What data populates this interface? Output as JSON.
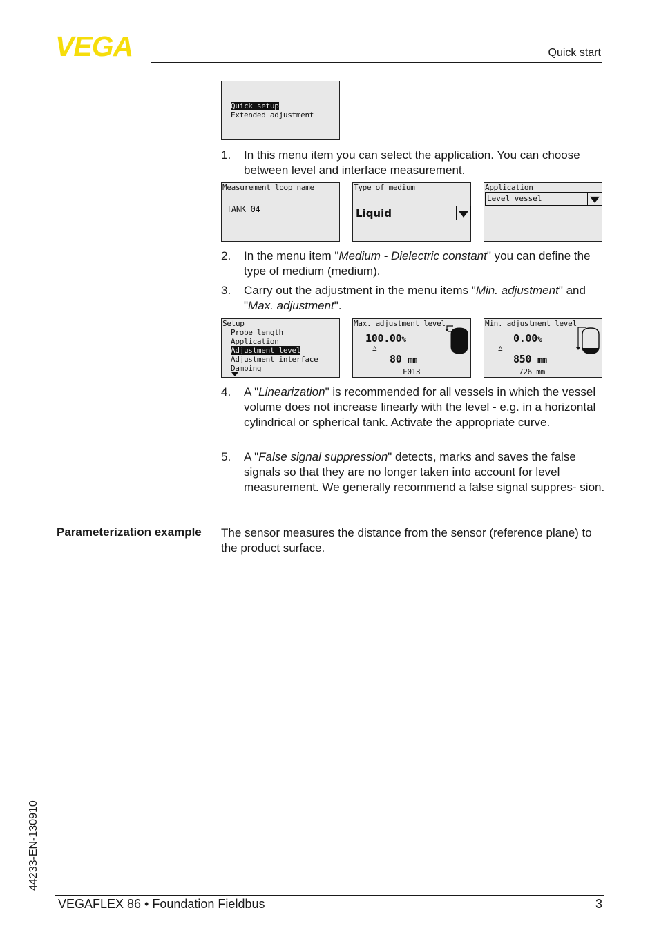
{
  "header": {
    "logo_text": "VEGA",
    "logo_color": "#f6dd0b",
    "section": "Quick start"
  },
  "screens": {
    "main_menu": {
      "items": [
        "Quick setup",
        "Extended adjustment"
      ],
      "selected": "Quick setup"
    },
    "loop_name": {
      "title": "Measurement loop name",
      "value": "TANK 04"
    },
    "medium": {
      "title": "Type of medium",
      "value": "Liquid"
    },
    "application": {
      "title": "Application",
      "value": "Level vessel"
    },
    "setup": {
      "title": "Setup",
      "items": [
        "Probe length",
        "Application",
        "Adjustment level",
        "Adjustment interface",
        "Damping"
      ],
      "selected": "Adjustment level"
    },
    "max_adj": {
      "title": "Max. adjustment level",
      "percent": "100.00",
      "percent_unit": "%",
      "equiv": "≙",
      "distance": "80",
      "distance_unit": "mm",
      "footer": "F013"
    },
    "min_adj": {
      "title": "Min. adjustment level",
      "percent": "0.00",
      "percent_unit": "%",
      "equiv": "≙",
      "distance": "850",
      "distance_unit": "mm",
      "footer": "726  mm"
    }
  },
  "steps": [
    {
      "num": "1.",
      "text": "In this menu item you can select the application. You can choose between level and interface measurement."
    },
    {
      "num": "2.",
      "pre": "In the menu item \"",
      "em": "Medium - Dielectric constant",
      "post": "\" you can define the type of medium (medium)."
    },
    {
      "num": "3.",
      "pre": "Carry out the adjustment in the menu items \"",
      "em": "Min. adjustment",
      "mid": "\" and \"",
      "em2": "Max. adjustment",
      "post": "\"."
    },
    {
      "num": "4.",
      "pre": "A \"",
      "em": "Linearization",
      "post": "\" is recommended for all vessels in which the vessel volume does not increase linearly with the level - e.g. in a horizontal cylindrical or spherical tank. Activate the appropriate curve."
    },
    {
      "num": "5.",
      "pre": "A \"",
      "em": "False signal suppression",
      "post": "\" detects, marks and saves the false signals so that they are no longer taken into account for level measurement. We generally recommend a false signal suppres- sion."
    }
  ],
  "param_example": {
    "label": "Parameterization example",
    "text": "The sensor measures the distance from the sensor (reference plane) to the product surface."
  },
  "footer": {
    "product": "VEGAFLEX 86 • Foundation Fieldbus",
    "page": "3",
    "doc_id": "44233-EN-130910"
  }
}
